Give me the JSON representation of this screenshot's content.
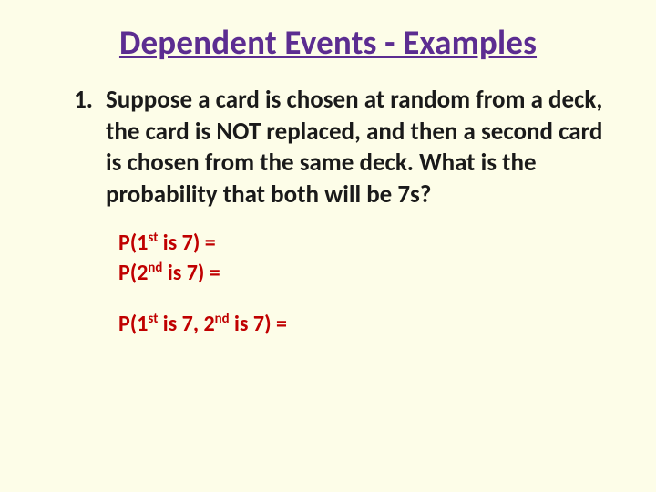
{
  "title": "Dependent Events - Examples",
  "list_number": "1.",
  "question": "Suppose a card is chosen at random from a deck, the card is NOT replaced, and then a second card is chosen from the same deck. What is the probability that both will be 7s?",
  "prob": {
    "line1_a": "P(1",
    "line1_sup": "st",
    "line1_b": " is 7) =",
    "line2_a": "P(2",
    "line2_sup": "nd",
    "line2_b": " is 7) =",
    "line3_a": "P(1",
    "line3_sup1": "st",
    "line3_b": " is 7, 2",
    "line3_sup2": "nd",
    "line3_c": " is 7) ="
  }
}
